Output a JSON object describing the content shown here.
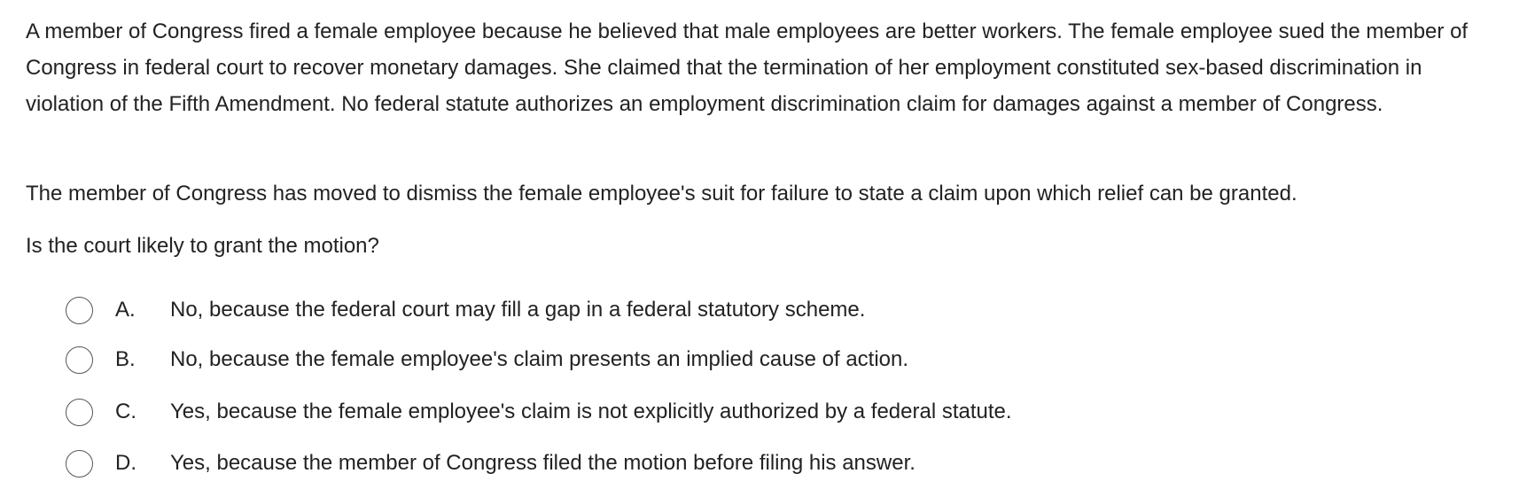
{
  "question": {
    "stem_paragraph_1": "A member of Congress fired a female employee because he believed that male employees are better workers.  The female employee sued the member of Congress in federal court to recover monetary damages.  She claimed that the termination of her employment constituted sex-based discrimination in violation of the Fifth Amendment.  No federal statute authorizes an employment discrimination claim for damages against a member of Congress.",
    "stem_paragraph_2": "The member of Congress has moved to dismiss the female employee's suit for failure to state a claim upon which relief can be granted.",
    "stem_paragraph_3": "Is the court likely to grant the motion?"
  },
  "choices": [
    {
      "letter": "A.",
      "text": "No, because the federal court may fill a gap in a federal statutory scheme."
    },
    {
      "letter": "B.",
      "text": "No, because the female employee's claim presents an implied cause of action."
    },
    {
      "letter": "C.",
      "text": "Yes, because the female employee's claim is not explicitly authorized by a federal statute."
    },
    {
      "letter": "D.",
      "text": "Yes, because the member of Congress filed the motion before filing his answer."
    }
  ]
}
